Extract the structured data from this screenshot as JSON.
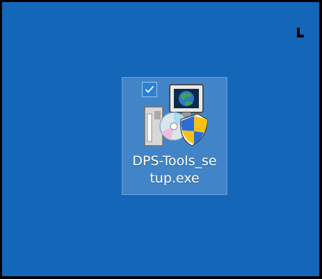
{
  "desktop": {
    "background_color": "#1466b9",
    "icons": [
      {
        "label_line1": "DPS-Tools_se",
        "label_line2": "tup.exe",
        "icon": "installer-setup-icon",
        "selected": true,
        "checked": true
      }
    ]
  },
  "cursor": {
    "icon": "mouse-cursor-icon"
  }
}
